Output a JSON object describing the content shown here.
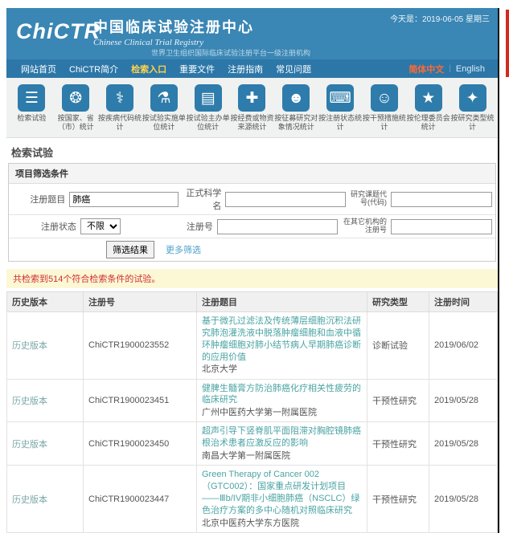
{
  "header": {
    "date_text": "今天是：2019-06-05 星期三",
    "logo": "ChiCTR",
    "title_cn": "中国临床试验注册中心",
    "title_en": "Chinese Clinical Trial Registry",
    "subtitle": "世界卫生组织国际临床试验注册平台一级注册机构"
  },
  "nav": {
    "items": [
      {
        "label": "网站首页",
        "active": false
      },
      {
        "label": "ChiCTR简介",
        "active": false
      },
      {
        "label": "检索入口",
        "active": true
      },
      {
        "label": "重要文件",
        "active": false
      },
      {
        "label": "注册指南",
        "active": false
      },
      {
        "label": "常见问题",
        "active": false
      }
    ],
    "lang_cn": "简体中文",
    "lang_sep": "|",
    "lang_en": "English"
  },
  "toolbar": {
    "items": [
      {
        "label": "检索试验",
        "icon": "list-icon",
        "glyph": "☰"
      },
      {
        "label": "按国家、省（市）统计",
        "icon": "world-map-icon",
        "glyph": "❂"
      },
      {
        "label": "按疾病代码统计",
        "icon": "dna-icon",
        "glyph": "⚕"
      },
      {
        "label": "按试验实施单位统计",
        "icon": "flask-icon",
        "glyph": "⚗"
      },
      {
        "label": "按试验主办单位统计",
        "icon": "clipboard-icon",
        "glyph": "▤"
      },
      {
        "label": "按经费或物资来源统计",
        "icon": "medkit-icon",
        "glyph": "✚"
      },
      {
        "label": "按征募研究对象情况统计",
        "icon": "people-icon",
        "glyph": "☻"
      },
      {
        "label": "按注册状态统计",
        "icon": "keyboard-icon",
        "glyph": "⌨"
      },
      {
        "label": "按干预措施统计",
        "icon": "person-icon",
        "glyph": "☺"
      },
      {
        "label": "按伦理委员会统计",
        "icon": "star-icon",
        "glyph": "★"
      },
      {
        "label": "按研究类型统计",
        "icon": "sparkle-icon",
        "glyph": "✦"
      }
    ]
  },
  "search": {
    "section_title": "检索试验",
    "panel_title": "项目筛选条件",
    "reg_title_label": "注册题目",
    "reg_title_value": "肺癌",
    "sci_name_label": "正式科学名",
    "sci_name_value": "",
    "code_label": "研究课题代号(代码)",
    "code_value": "",
    "status_label": "注册状态",
    "status_value": "不限",
    "reg_no_label": "注册号",
    "reg_no_value": "",
    "other_reg_label": "在其它机构的注册号",
    "other_reg_value": "",
    "filter_button": "筛选结果",
    "more_link": "更多筛选"
  },
  "results": {
    "summary": "共检索到514个符合检索条件的试验。",
    "headers": [
      "历史版本",
      "注册号",
      "注册题目",
      "研究类型",
      "注册时间"
    ],
    "rows": [
      {
        "history": "历史版本",
        "reg_no": "ChiCTR1900023552",
        "title": "基于微孔过滤法及传统薄层细胞沉积法研究肺泡灌洗液中脱落肿瘤细胞和血液中循环肿瘤细胞对肺小结节病人早期肺癌诊断的应用价值",
        "org": "北京大学",
        "type": "诊断试验",
        "date": "2019/06/02"
      },
      {
        "history": "历史版本",
        "reg_no": "ChiCTR1900023451",
        "title": "健脾生髓膏方防治肺癌化疗相关性疲劳的临床研究",
        "org": "广州中医药大学第一附属医院",
        "type": "干预性研究",
        "date": "2019/05/28"
      },
      {
        "history": "历史版本",
        "reg_no": "ChiCTR1900023450",
        "title": "超声引导下竖脊肌平面阻滞对胸腔镜肺癌根治术患者应激反应的影响",
        "org": "南昌大学第一附属医院",
        "type": "干预性研究",
        "date": "2019/05/28"
      },
      {
        "history": "历史版本",
        "reg_no": "ChiCTR1900023447",
        "title": "Green Therapy of Cancer 002（GTC002）：国家重点研发计划项目——Ⅲb/IV期非小细胞肺癌（NSCLC）绿色治疗方案的多中心随机对照临床研究",
        "org": "北京中医药大学东方医院",
        "type": "干预性研究",
        "date": "2019/05/28"
      }
    ]
  },
  "colors": {
    "header_blue": "#3a86b4",
    "nav_blue": "#2c77a8",
    "icon_blue": "#2e7cab",
    "nav_active_yellow": "#ffd24a",
    "lang_orange": "#ff6a33",
    "notice_bg": "#fcf7d5",
    "notice_red": "#d03030",
    "link_teal": "#4aa3a3",
    "red_edge": "#d42a1e"
  }
}
